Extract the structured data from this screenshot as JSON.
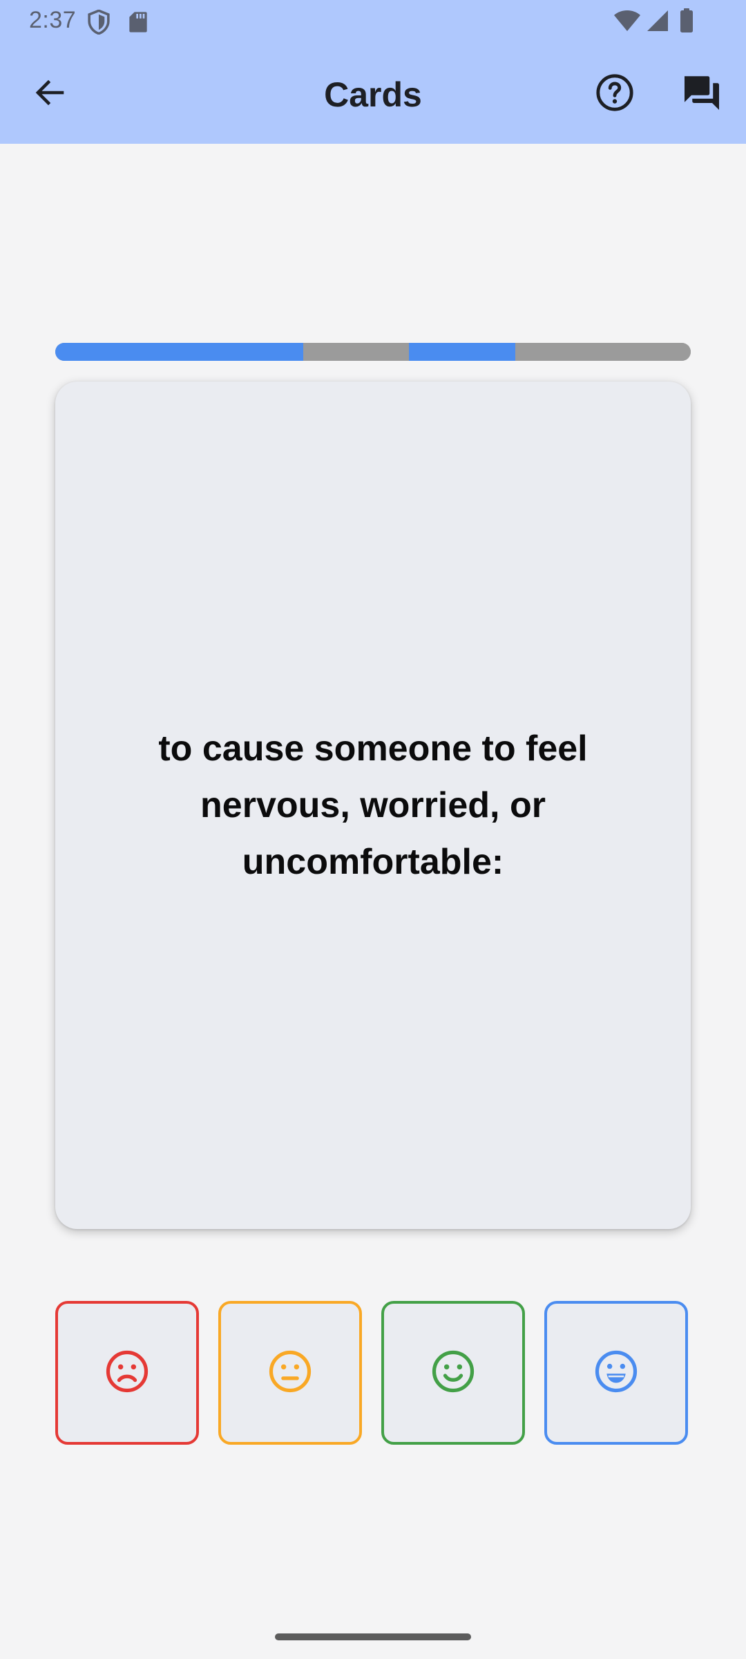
{
  "status_bar": {
    "time": "2:37",
    "icons": [
      "shield-icon",
      "sd-card-icon",
      "wifi-icon",
      "signal-icon",
      "battery-icon"
    ]
  },
  "app_bar": {
    "title": "Cards",
    "icons": [
      "back-arrow-icon",
      "help-icon",
      "forum-icon"
    ]
  },
  "progress": {
    "segments": [
      {
        "state": "done",
        "fraction": 0.39
      },
      {
        "state": "pending",
        "fraction": 0.167
      },
      {
        "state": "done",
        "fraction": 0.167
      },
      {
        "state": "pending",
        "fraction": 0.276
      }
    ]
  },
  "card": {
    "text": "to cause someone to feel nervous, worried, or uncomfortable:"
  },
  "ratings": [
    {
      "icon": "sad-face-icon",
      "color": "#e53935"
    },
    {
      "icon": "neutral-face-icon",
      "color": "#f9a825"
    },
    {
      "icon": "smile-face-icon",
      "color": "#43a047"
    },
    {
      "icon": "grin-face-icon",
      "color": "#4a8cf0"
    }
  ],
  "colors": {
    "app_bar": "#afc8fd",
    "progress_done": "#4a8cf0",
    "progress_pending": "#9b9b9b",
    "card_background": "#eaecf1",
    "page_background": "#f4f4f5"
  }
}
